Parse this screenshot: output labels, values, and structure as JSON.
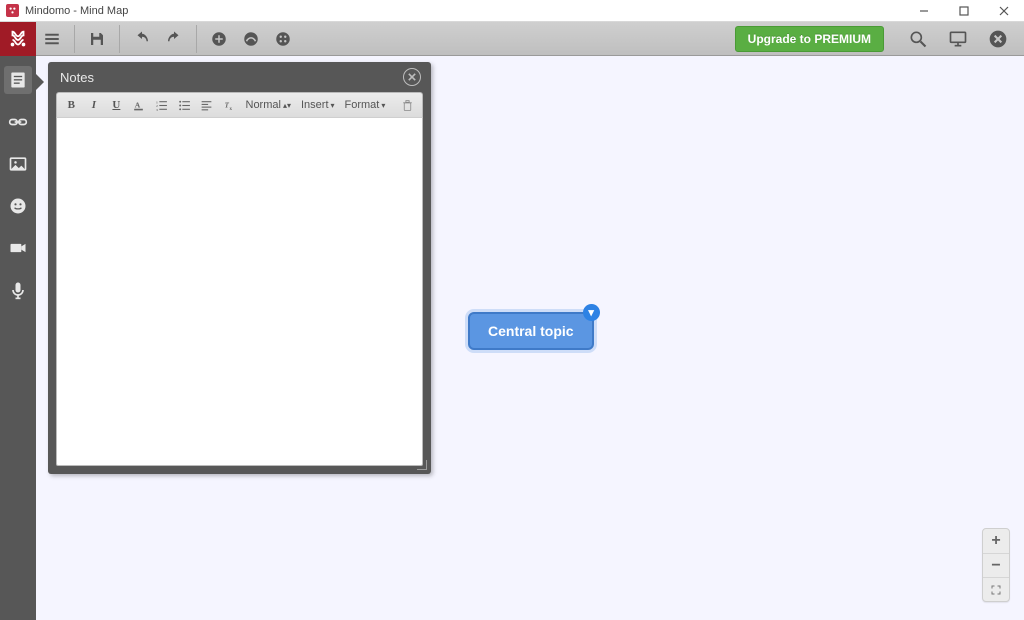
{
  "window": {
    "title": "Mindomo - Mind Map"
  },
  "toolbar": {
    "premium_label": "Upgrade to PREMIUM"
  },
  "side_rail": {
    "items": [
      {
        "name": "notes",
        "active": true
      },
      {
        "name": "hyperlink"
      },
      {
        "name": "image"
      },
      {
        "name": "emoji"
      },
      {
        "name": "video"
      },
      {
        "name": "audio"
      }
    ]
  },
  "notes_panel": {
    "title": "Notes",
    "style_dropdown": "Normal",
    "insert_dropdown": "Insert",
    "format_dropdown": "Format"
  },
  "node": {
    "label": "Central topic"
  }
}
